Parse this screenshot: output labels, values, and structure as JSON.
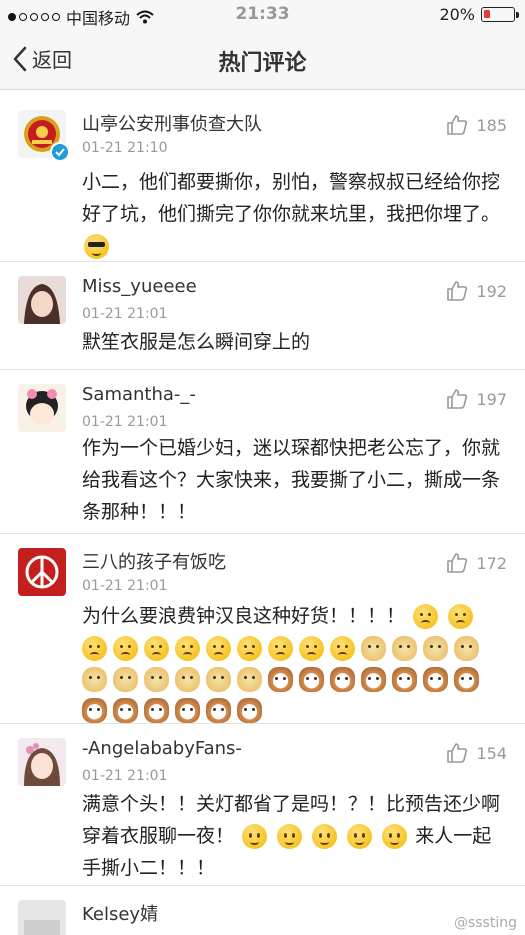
{
  "status_bar": {
    "carrier": "中国移动",
    "time": "21:33",
    "battery_text": "20%",
    "battery_level": 0.2,
    "signal_bars_filled": 1,
    "signal_bars_total": 5
  },
  "nav": {
    "back_label": "返回",
    "title": "热门评论"
  },
  "comments": [
    {
      "name": "山亭公安刑事侦查大队",
      "time": "01-21 21:10",
      "likes": "185",
      "text_1": "小二，他们都要撕你，别怕，警察叔叔已经给你挖好了坑，他们撕完了你你就来坑里，我把你埋了。",
      "verified": true
    },
    {
      "name": "Miss_yueeee",
      "time": "01-21 21:01",
      "likes": "192",
      "text_1": "默笙衣服是怎么瞬间穿上的"
    },
    {
      "name": "Samantha-_-",
      "time": "01-21 21:01",
      "likes": "197",
      "text_1": "作为一个已婚少妇，迷以琛都快把老公忘了，你就给我看这个？大家快来，我要撕了小二，撕成一条条那种！！！"
    },
    {
      "name": "三八的孩子有饭吃",
      "time": "01-21 21:01",
      "likes": "172",
      "text_1": "为什么要浪费钟汉良这种好货！！！！"
    },
    {
      "name": "-AngelababyFans-",
      "time": "01-21 21:01",
      "likes": "154",
      "text_1": "满意个头！！关灯都省了是吗！？！比预告还少啊穿着衣服聊一夜！",
      "text_2": "来人一起手撕小二！！！"
    },
    {
      "name": "Kelsey婧"
    }
  ],
  "watermark": "@sssting"
}
